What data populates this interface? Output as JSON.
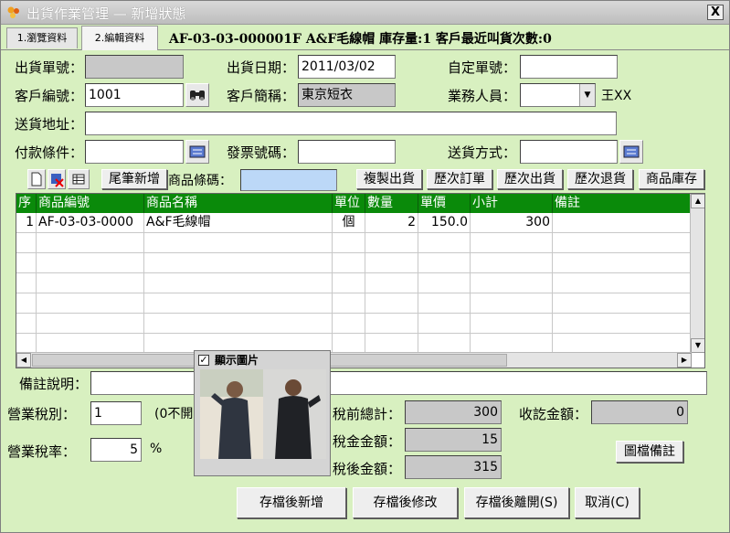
{
  "window": {
    "title": "出貨作業管理 — 新增狀態",
    "close_label": "X"
  },
  "tabs": [
    {
      "label": "1.瀏覽資料"
    },
    {
      "label": "2.編輯資料"
    }
  ],
  "info_line": "AF-03-03-000001F A&F毛線帽 庫存量:1   客戶最近叫貨次數:0",
  "form": {
    "ship_no_label": "出貨單號：",
    "ship_no_value": "",
    "ship_date_label": "出貨日期：",
    "ship_date_value": "2011/03/02",
    "custom_no_label": "自定單號：",
    "custom_no_value": "",
    "customer_code_label": "客戶編號：",
    "customer_code_value": "1001",
    "customer_short_label": "客戶簡稱：",
    "customer_short_value": "東京短衣",
    "salesperson_label": "業務人員：",
    "salesperson_value": "",
    "salesperson_name": "王XX",
    "address_label": "送貨地址：",
    "address_value": "",
    "payment_label": "付款條件：",
    "payment_value": "",
    "invoice_label": "發票號碼：",
    "invoice_value": "",
    "delivery_label": "送貨方式：",
    "delivery_value": ""
  },
  "toolbar": {
    "append_label": "尾筆新增",
    "barcode_label": "商品條碼：",
    "barcode_value": "",
    "buttons": [
      "複製出貨",
      "歷次訂單",
      "歷次出貨",
      "歷次退貨",
      "商品庫存"
    ]
  },
  "grid": {
    "columns": [
      "序",
      "商品編號",
      "商品名稱",
      "單位",
      "數量",
      "單價",
      "小計",
      "備註"
    ],
    "rows": [
      [
        "1",
        "AF-03-03-0000",
        "A&F毛線帽",
        "個",
        "2",
        "150.0",
        "300",
        ""
      ]
    ]
  },
  "photo": {
    "label": "顯示圖片",
    "checked": "✓"
  },
  "footer": {
    "remarks_label": "備註說明：",
    "remarks_value": "",
    "tax_type_label": "營業稅別：",
    "tax_type_value": "1",
    "tax_type_hint": "(0不開",
    "tax_rate_label": "營業稅率：",
    "tax_rate_value": "5",
    "tax_rate_unit": "%",
    "pretax_label": "稅前總計：",
    "pretax_value": "300",
    "tax_amount_label": "稅金金額：",
    "tax_amount_value": "15",
    "after_tax_label": "稅後金額：",
    "after_tax_value": "315",
    "received_label": "收訖金額：",
    "received_value": "0",
    "image_note_label": "圖檔備註"
  },
  "actions": {
    "save_new": "存檔後新增",
    "save_edit": "存檔後修改",
    "save_exit": "存檔後離開(S)",
    "cancel": "取消(C)"
  },
  "colors": {
    "window_bg": "#d8f0c0",
    "grid_header": "#0a8a0a",
    "readonly_field": "#c8c8c8",
    "barcode_field": "#bcd8f7"
  }
}
